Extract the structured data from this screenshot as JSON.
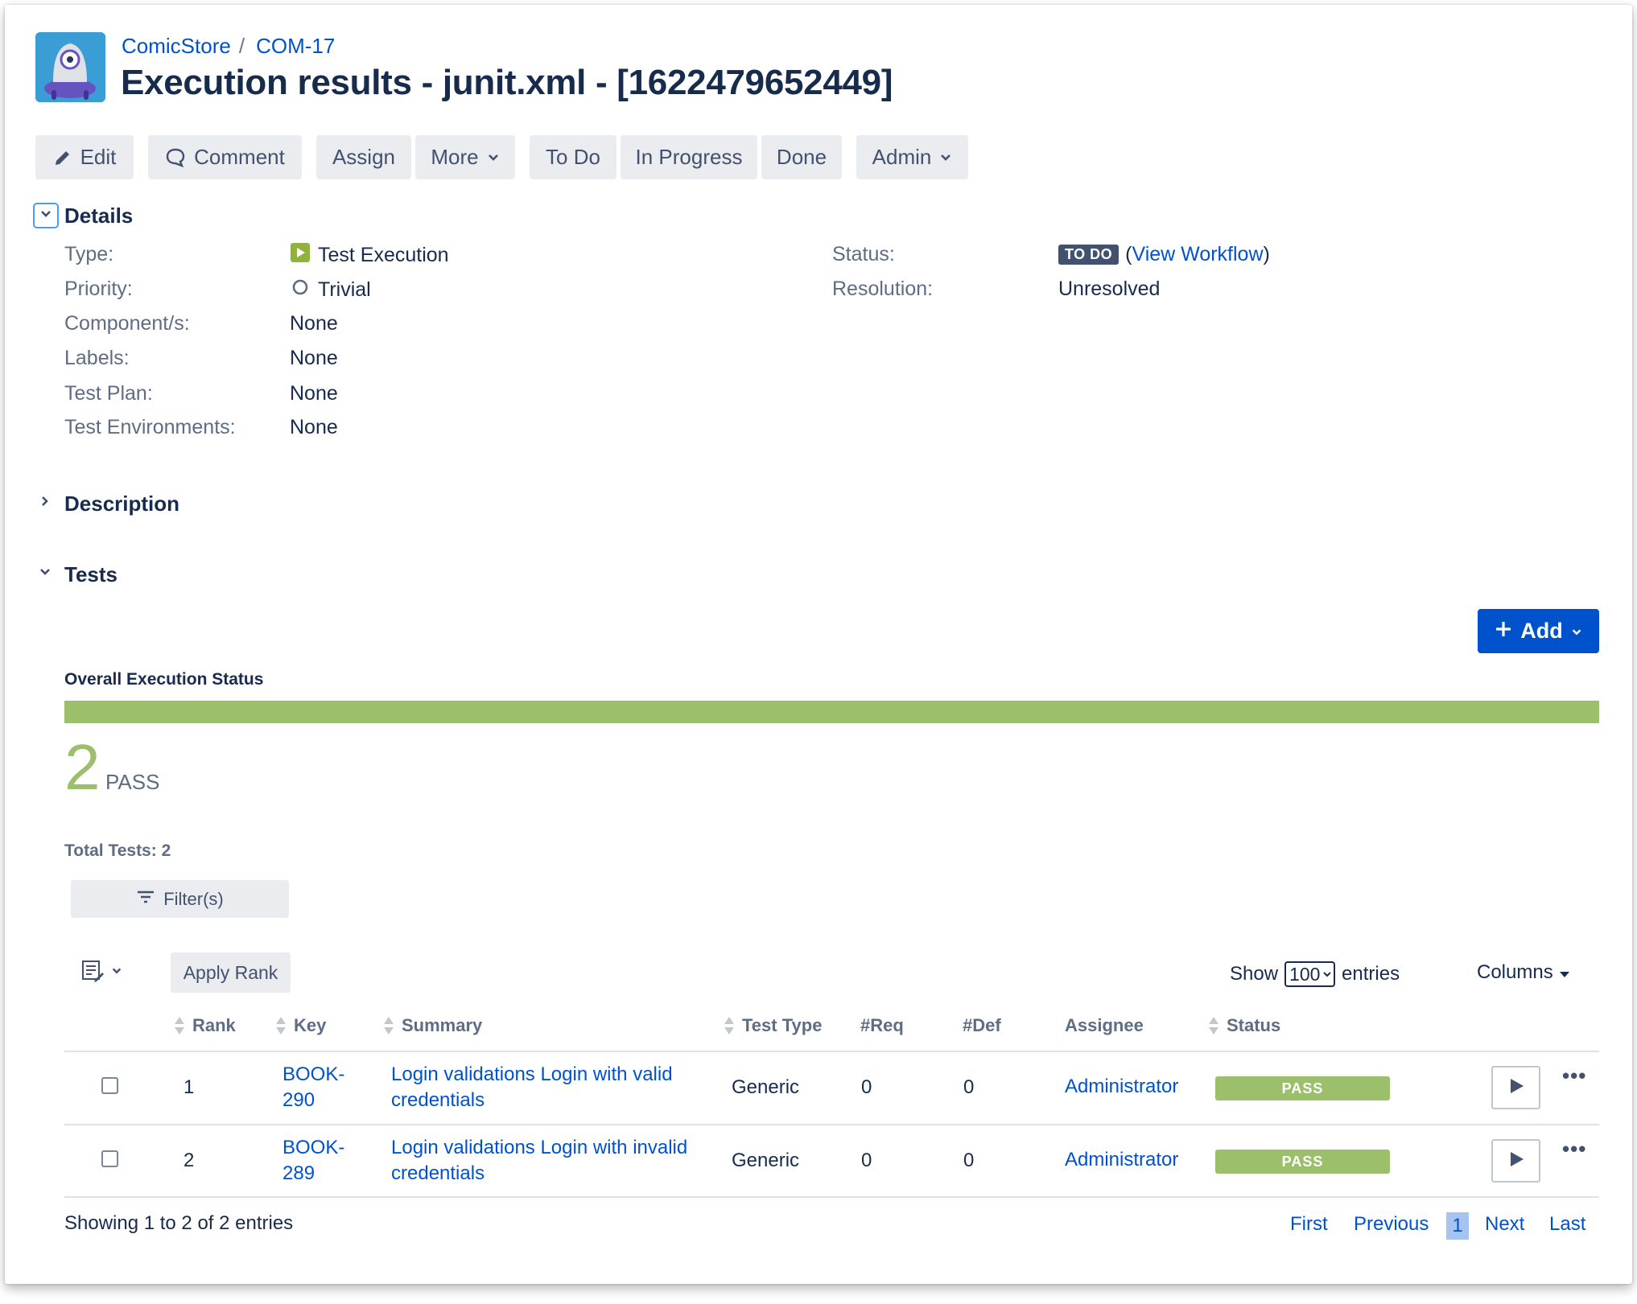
{
  "breadcrumb": {
    "project": "ComicStore",
    "separator": "/",
    "issue_key": "COM-17"
  },
  "issue_title": "Execution results - junit.xml - [1622479652449]",
  "toolbar": {
    "edit": "Edit",
    "comment": "Comment",
    "assign": "Assign",
    "more": "More",
    "todo": "To Do",
    "in_progress": "In Progress",
    "done": "Done",
    "admin": "Admin"
  },
  "details": {
    "title": "Details",
    "type_label": "Type:",
    "type_value": "Test Execution",
    "priority_label": "Priority:",
    "priority_value": "Trivial",
    "component_label": "Component/s:",
    "component_value": "None",
    "labels_label": "Labels:",
    "labels_value": "None",
    "testplan_label": "Test Plan:",
    "testplan_value": "None",
    "testenv_label": "Test Environments:",
    "testenv_value": "None",
    "status_label": "Status:",
    "status_value": "TO DO",
    "view_workflow": "View Workflow",
    "resolution_label": "Resolution:",
    "resolution_value": "Unresolved"
  },
  "description": {
    "title": "Description"
  },
  "tests": {
    "title": "Tests",
    "add_label": "Add",
    "overall_status_label": "Overall Execution Status",
    "pass_count": "2",
    "pass_label": "PASS",
    "pass_fraction": 1.0,
    "total_tests": "Total Tests: 2",
    "filter_label": "Filter(s)",
    "apply_rank": "Apply Rank",
    "show_label": "Show",
    "entries_value": "100",
    "entries_label": "entries",
    "columns_label": "Columns",
    "headers": {
      "rank": "Rank",
      "key": "Key",
      "summary": "Summary",
      "test_type": "Test Type",
      "req": "#Req",
      "def": "#Def",
      "assignee": "Assignee",
      "status": "Status"
    },
    "rows": [
      {
        "rank": "1",
        "key_line1": "BOOK-",
        "key_line2": "290",
        "summary_line1": "Login validations Login with valid",
        "summary_line2": "credentials",
        "test_type": "Generic",
        "req": "0",
        "def": "0",
        "assignee": "Administrator",
        "status": "PASS"
      },
      {
        "rank": "2",
        "key_line1": "BOOK-",
        "key_line2": "289",
        "summary_line1": "Login validations Login with invalid",
        "summary_line2": "credentials",
        "test_type": "Generic",
        "req": "0",
        "def": "0",
        "assignee": "Administrator",
        "status": "PASS"
      }
    ],
    "showing": "Showing 1 to 2 of 2 entries",
    "pagination": {
      "first": "First",
      "previous": "Previous",
      "current": "1",
      "next": "Next",
      "last": "Last"
    }
  },
  "colors": {
    "accent": "#0052cc",
    "pass": "#9bbf6b",
    "lozenge_todo": "#42526e"
  },
  "icons": [
    "project-avatar-icon",
    "pencil-icon",
    "comment-icon",
    "chevron-down-icon",
    "chevron-right-icon",
    "test-execution-icon",
    "priority-trivial-icon",
    "plus-icon",
    "filter-icon",
    "bulk-edit-icon",
    "play-icon",
    "more-icon"
  ]
}
